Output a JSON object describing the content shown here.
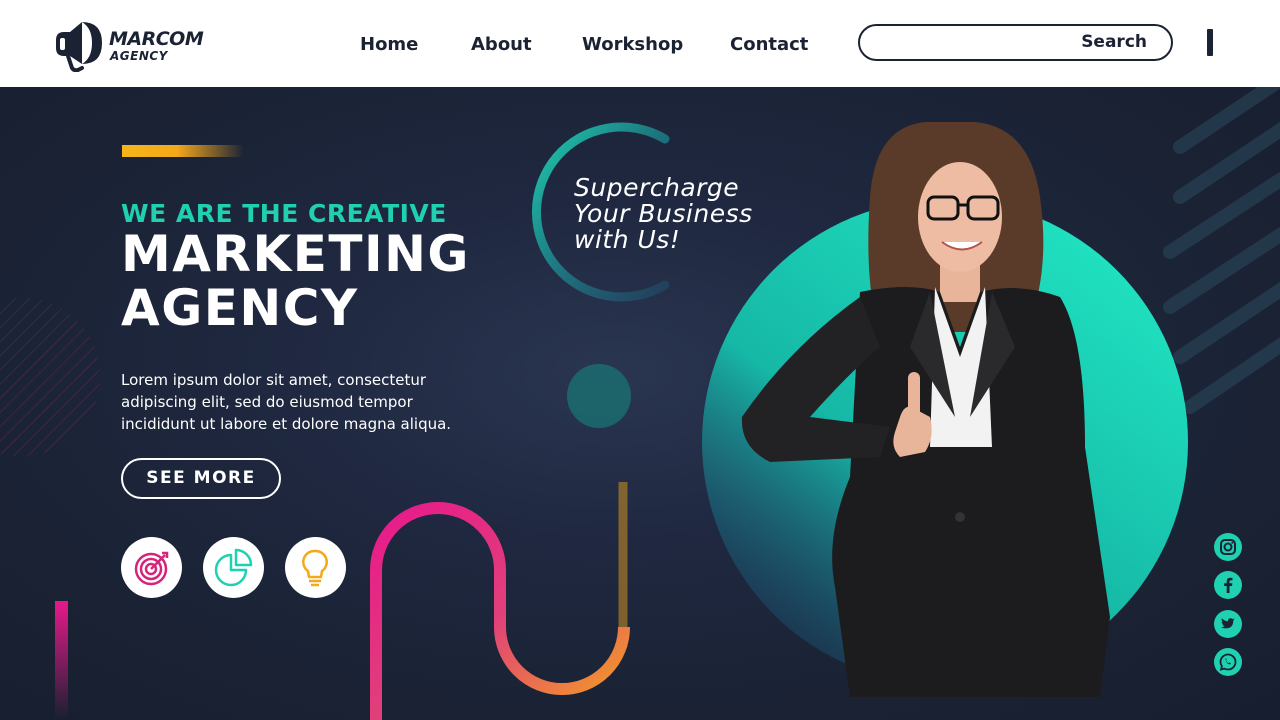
{
  "brand": {
    "name": "MARCOM",
    "subtitle": "AGENCY"
  },
  "nav": {
    "items": [
      "Home",
      "About",
      "Workshop",
      "Contact"
    ]
  },
  "search": {
    "placeholder": "",
    "button_label": "Search"
  },
  "hero": {
    "tagline": "WE ARE THE CREATIVE",
    "headline_line1": "MARKETING",
    "headline_line2": "AGENCY",
    "body_line1": "Lorem ipsum dolor sit amet, consectetur",
    "body_line2": "adipiscing elit, sed do eiusmod tempor",
    "body_line3": "incididunt ut labore et dolore magna aliqua.",
    "cta_label": "SEE MORE",
    "promo_line1": "Supercharge",
    "promo_line2": "Your Business",
    "promo_line3": "with Us!"
  },
  "features": [
    {
      "icon": "target-icon",
      "color": "#d6247a"
    },
    {
      "icon": "pie-chart-icon",
      "color": "#1fd1b0"
    },
    {
      "icon": "lightbulb-icon",
      "color": "#f5a81a"
    }
  ],
  "social": [
    "instagram-icon",
    "facebook-icon",
    "twitter-icon",
    "whatsapp-icon"
  ],
  "colors": {
    "background": "#1a2234",
    "accent_teal": "#1fd1b0",
    "accent_pink": "#e8198b",
    "accent_orange": "#f5a81a",
    "text_dark": "#1b2233"
  }
}
